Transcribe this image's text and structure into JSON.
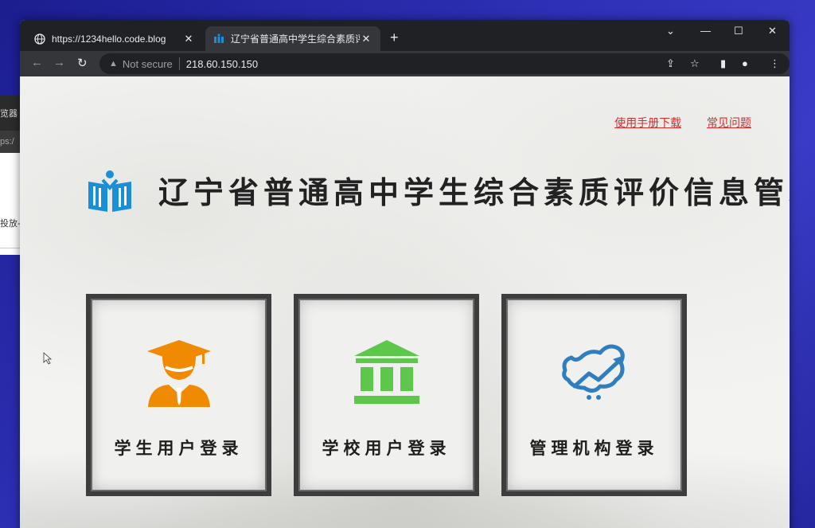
{
  "background_window": {
    "title_fragment": "览器",
    "addr_fragment": "ps:/",
    "body_fragment": "投放-"
  },
  "browser": {
    "tabs": [
      {
        "title": "https://1234hello.code.blog",
        "icon": "globe-icon"
      },
      {
        "title": "辽宁省普通高中学生综合素质评价",
        "icon": "site-logo-icon",
        "active": true
      }
    ],
    "new_tab": "+",
    "address": {
      "security": "Not secure",
      "url": "218.60.150.150"
    }
  },
  "page": {
    "links": [
      "使用手册下载",
      "常见问题"
    ],
    "title": "辽宁省普通高中学生综合素质评价信息管理平",
    "cards": [
      {
        "label": "学生用户登录",
        "icon": "student-icon",
        "color": "#f08a00"
      },
      {
        "label": "学校用户登录",
        "icon": "school-building-icon",
        "color": "#5cc74a"
      },
      {
        "label": "管理机构登录",
        "icon": "map-chart-icon",
        "color": "#2f7fc0"
      }
    ]
  },
  "colors": {
    "link": "#d32f2f",
    "logo": "#1a8fd8",
    "chrome_dark": "#202124",
    "chrome_toolbar": "#35363a"
  }
}
